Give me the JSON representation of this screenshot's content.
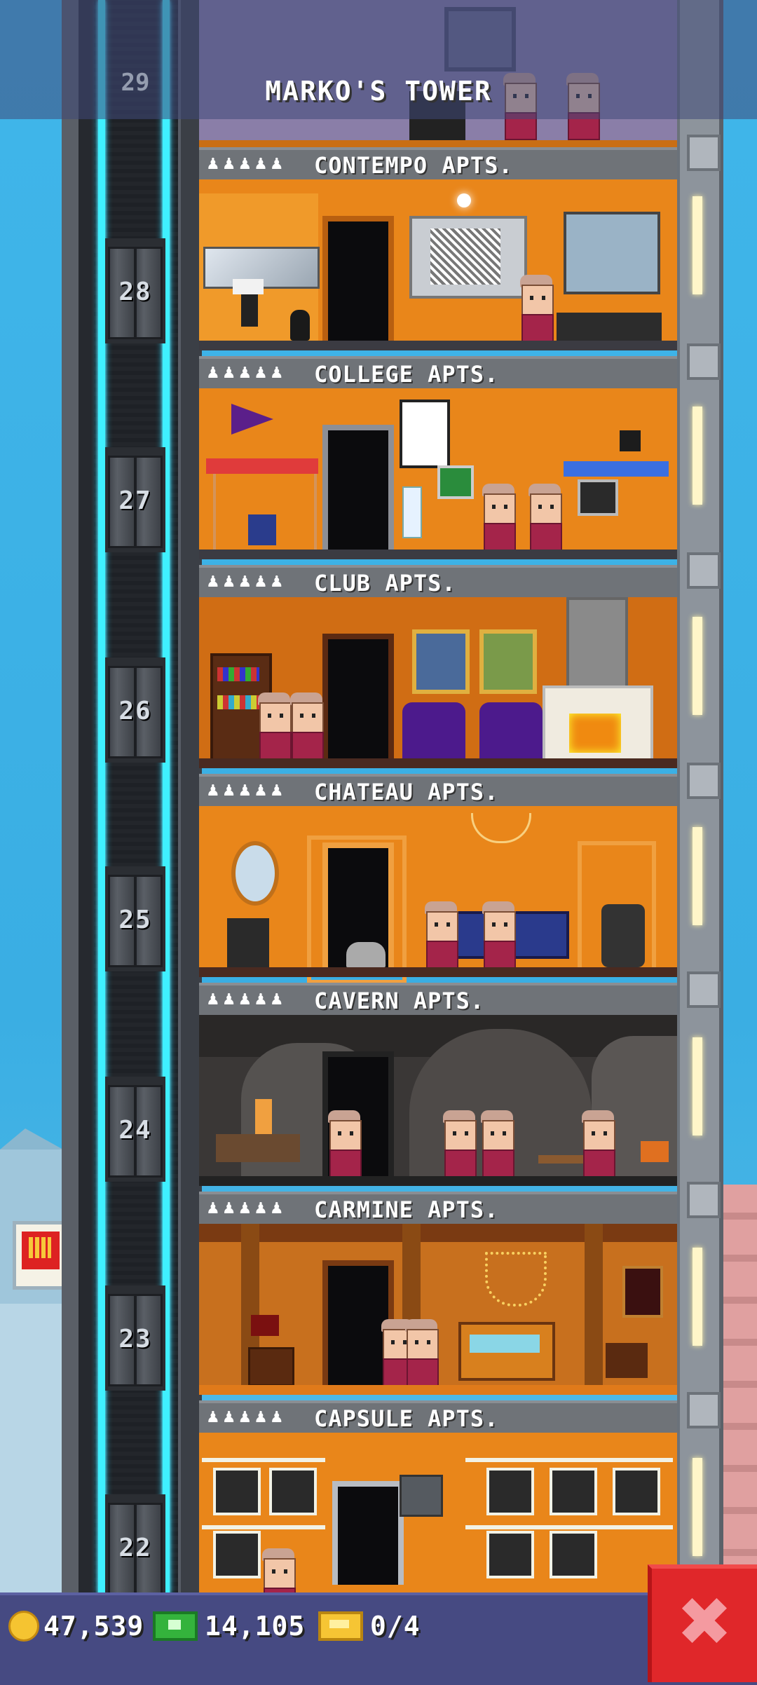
{
  "tower": {
    "title": "MARKO'S TOWER",
    "top_floor_number": "29"
  },
  "floors": [
    {
      "number": "28",
      "people_icons": "♟♟♟♟♟",
      "name": "CONTEMPO APTS."
    },
    {
      "number": "27",
      "people_icons": "♟♟♟♟♟",
      "name": "COLLEGE APTS."
    },
    {
      "number": "26",
      "people_icons": "♟♟♟♟♟",
      "name": "CLUB APTS."
    },
    {
      "number": "25",
      "people_icons": "♟♟♟♟♟",
      "name": "CHATEAU APTS."
    },
    {
      "number": "24",
      "people_icons": "♟♟♟♟♟",
      "name": "CAVERN APTS."
    },
    {
      "number": "23",
      "people_icons": "♟♟♟♟♟",
      "name": "CARMINE APTS."
    },
    {
      "number": "22",
      "people_icons": "♟♟♟♟♟",
      "name": "CAPSULE APTS."
    }
  ],
  "status_bar": {
    "coins": "47,539",
    "tower_bux": "14,105",
    "tickets": "0/4",
    "close_label": "✖"
  },
  "colors": {
    "sky": "#40b6ea",
    "elevator_cable": "#3ff0ff",
    "apartment_wall": "#e9861a",
    "close_button": "#e0272a",
    "bottom_bar": "#464a82"
  }
}
